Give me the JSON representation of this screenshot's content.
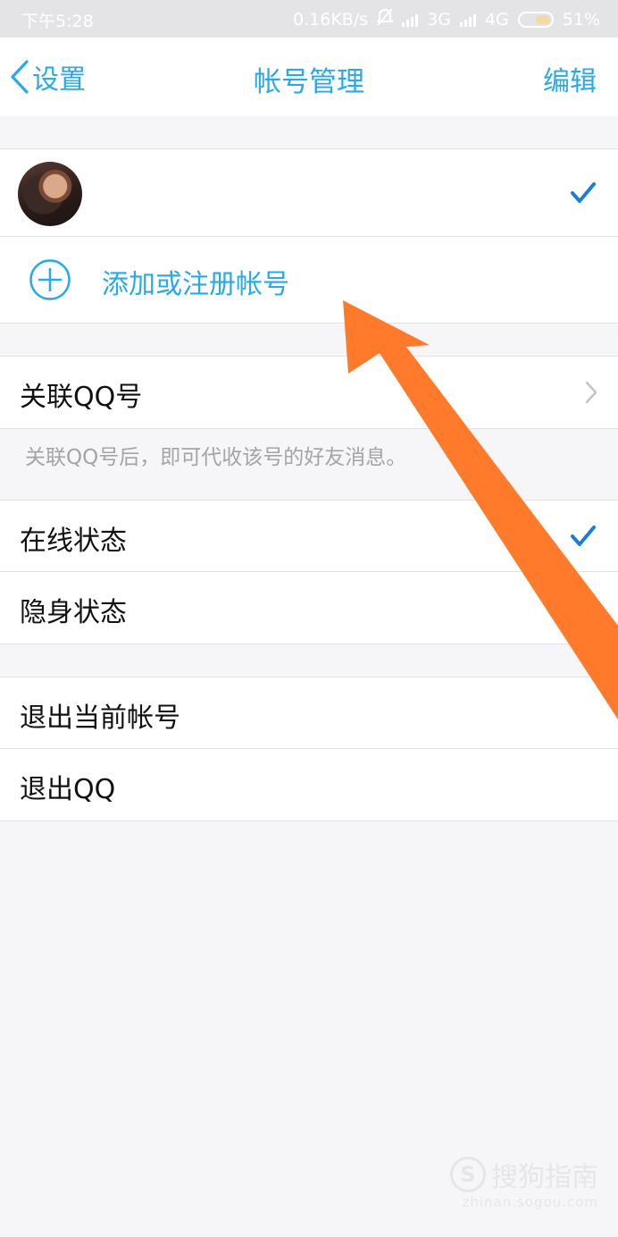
{
  "status_bar": {
    "time": "下午5:28",
    "network_speed": "0.16KB/s",
    "network_3g": "3G",
    "network_4g": "4G",
    "battery": "51%"
  },
  "nav": {
    "back_label": "设置",
    "title": "帐号管理",
    "edit_label": "编辑"
  },
  "accounts": {
    "add_label": "添加或注册帐号"
  },
  "link_qq": {
    "label": "关联QQ号",
    "hint": "关联QQ号后，即可代收该号的好友消息。"
  },
  "status_options": {
    "online": "在线状态",
    "invisible": "隐身状态"
  },
  "exit": {
    "logout_current": "退出当前帐号",
    "quit_qq": "退出QQ"
  },
  "watermark": {
    "logo": "S",
    "title": "搜狗指南",
    "url": "zhinan.sogou.com"
  },
  "colors": {
    "accent": "#29a9e8",
    "check": "#1a7fd4",
    "arrow": "#ff7a2a"
  }
}
